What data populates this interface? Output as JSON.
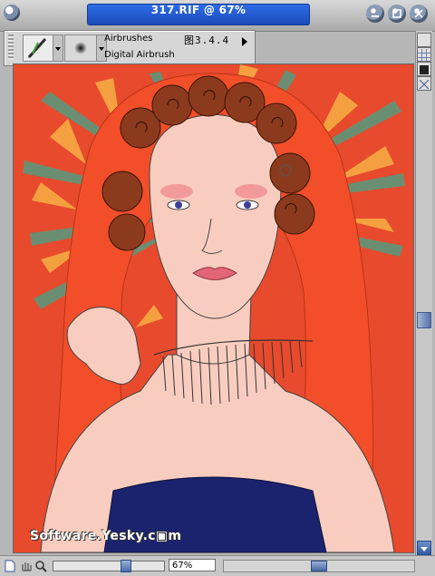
{
  "window": {
    "title": "317.RIF @ 67%"
  },
  "property_bar": {
    "brush_category": "Airbrushes",
    "brush_variant": "Digital Airbrush",
    "figure_number": "图3.4.4"
  },
  "canvas": {
    "watermark": "Software.Yesky.c▣m"
  },
  "status_bar": {
    "zoom_value": "67%",
    "zoom_fraction": 0.67
  },
  "colors": {
    "title_blue": "#1f5bd6",
    "canvas_red": "#e84a2d",
    "hair": "#8c3a1e",
    "dress": "#1b236e",
    "skin": "#f8cdbf"
  }
}
